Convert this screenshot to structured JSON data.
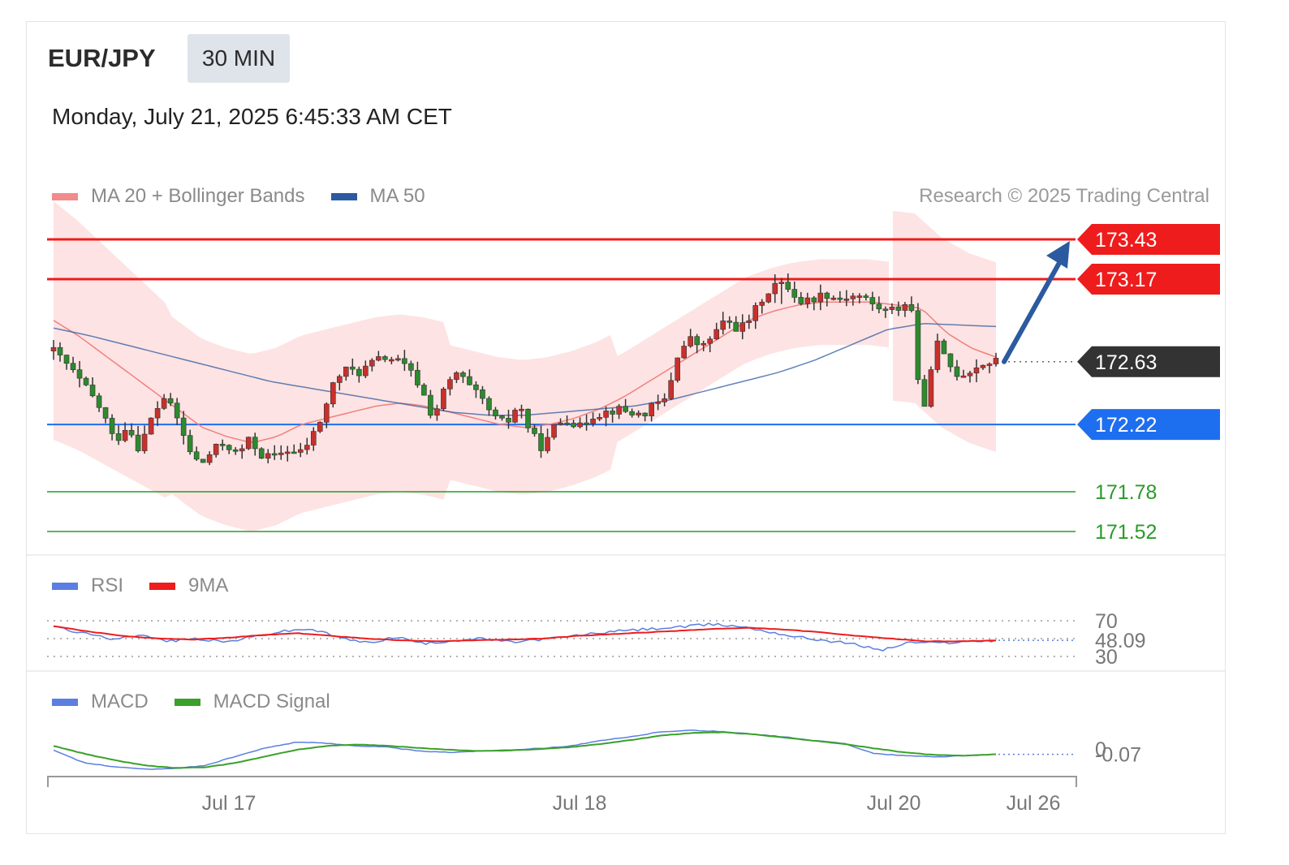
{
  "header": {
    "pair": "EUR/JPY",
    "timeframe": "30 MIN",
    "datetime": "Monday, July 21, 2025 6:45:33 AM CET",
    "credit": "Research © 2025 Trading Central"
  },
  "legends": {
    "price": [
      {
        "label": "MA 20 + Bollinger Bands",
        "color": "#f28b8b"
      },
      {
        "label": "MA 50",
        "color": "#2c5aa0"
      }
    ],
    "rsi": [
      {
        "label": "RSI",
        "color": "#5b7fe0"
      },
      {
        "label": "9MA",
        "color": "#ee1c1c"
      }
    ],
    "macd": [
      {
        "label": "MACD",
        "color": "#5b7fe0"
      },
      {
        "label": "MACD Signal",
        "color": "#3aa02a"
      }
    ]
  },
  "levels": [
    {
      "value": 173.43,
      "label": "173.43",
      "kind": "resistance",
      "color": "#ee1c1c"
    },
    {
      "value": 173.17,
      "label": "173.17",
      "kind": "resistance",
      "color": "#ee1c1c"
    },
    {
      "value": 172.63,
      "label": "172.63",
      "kind": "last",
      "color": "#333333"
    },
    {
      "value": 172.22,
      "label": "172.22",
      "kind": "pivot",
      "color": "#1e6ef0"
    },
    {
      "value": 171.78,
      "label": "171.78",
      "kind": "support",
      "color": "#2a9a2a"
    },
    {
      "value": 171.52,
      "label": "171.52",
      "kind": "support",
      "color": "#2a9a2a"
    }
  ],
  "chart_data": [
    {
      "type": "candlestick",
      "panel": "price",
      "ylim": [
        171.4,
        173.6
      ],
      "x_ticks": [
        "Jul 17",
        "Jul 18",
        "Jul 20",
        "Jul 26"
      ],
      "last_price": 172.63,
      "projection": {
        "from": 172.63,
        "to": 173.43,
        "color": "#2c5aa0"
      },
      "close_path": [
        172.7,
        172.62,
        172.52,
        172.42,
        172.3,
        172.1,
        172.22,
        172.06,
        172.26,
        172.4,
        172.28,
        172.06,
        171.95,
        172.05,
        172.1,
        172.02,
        172.12,
        172.02,
        172.0,
        172.06,
        172.02,
        172.12,
        172.28,
        172.52,
        172.58,
        172.56,
        172.62,
        172.66,
        172.64,
        172.58,
        172.46,
        172.26,
        172.46,
        172.56,
        172.46,
        172.38,
        172.26,
        172.22,
        172.36,
        172.16,
        172.06,
        172.22,
        172.26,
        172.2,
        172.28,
        172.3,
        172.32,
        172.3,
        172.28,
        172.34,
        172.38,
        172.68,
        172.78,
        172.72,
        172.82,
        172.9,
        172.84,
        172.92,
        173.06,
        173.14,
        173.12,
        173.02,
        173.04,
        173.08,
        173.04,
        173.06,
        173.06,
        173.0,
        172.96,
        172.98,
        173.04,
        172.22,
        172.78,
        172.62,
        172.54,
        172.58,
        172.62,
        172.63
      ],
      "ma20_path": [
        172.9,
        172.8,
        172.68,
        172.56,
        172.44,
        172.32,
        172.2,
        172.14,
        172.1,
        172.14,
        172.22,
        172.26,
        172.3,
        172.34,
        172.36,
        172.34,
        172.3,
        172.26,
        172.22,
        172.2,
        172.22,
        172.26,
        172.32,
        172.4,
        172.5,
        172.6,
        172.7,
        172.8,
        172.9,
        172.96,
        173.0,
        173.02,
        173.02,
        173.02,
        173.0,
        172.98,
        172.82,
        172.72,
        172.66
      ],
      "ma50_path": [
        172.85,
        172.8,
        172.74,
        172.68,
        172.62,
        172.56,
        172.5,
        172.46,
        172.42,
        172.38,
        172.34,
        172.3,
        172.28,
        172.28,
        172.3,
        172.32,
        172.34,
        172.38,
        172.44,
        172.5,
        172.56,
        172.64,
        172.74,
        172.84,
        172.88,
        172.87,
        172.86
      ]
    },
    {
      "type": "line",
      "panel": "rsi",
      "series": [
        {
          "name": "RSI"
        },
        {
          "name": "9MA"
        }
      ],
      "reference_lines": [
        70,
        50,
        30
      ],
      "tick_labels": [
        "70",
        "30"
      ],
      "last_value": 48.09,
      "last_label": "48.09"
    },
    {
      "type": "line",
      "panel": "macd",
      "series": [
        {
          "name": "MACD"
        },
        {
          "name": "MACD Signal"
        }
      ],
      "tick_labels": [
        "0"
      ],
      "last_value": -0.07,
      "last_label": "-0.07"
    }
  ]
}
